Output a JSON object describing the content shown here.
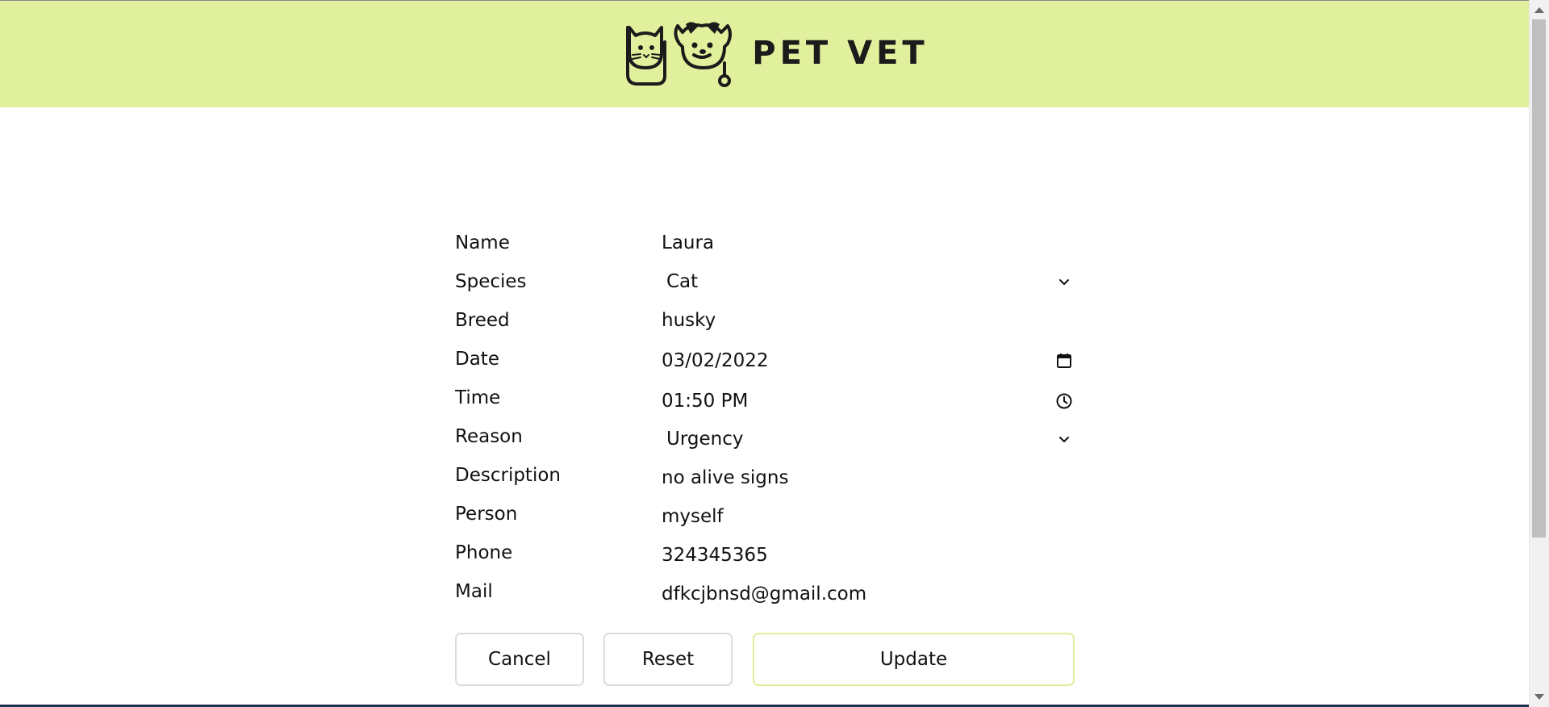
{
  "header": {
    "logo_text": "PET VET",
    "logo_mark": "cat-dog-stethoscope-logo",
    "background": "#e1f09c"
  },
  "form": {
    "fields": [
      {
        "label": "Name",
        "value": "Laura"
      },
      {
        "label": "Species",
        "value": "Cat",
        "control": "select"
      },
      {
        "label": "Breed",
        "value": "husky"
      },
      {
        "label": "Date",
        "value": "03/02/2022",
        "icon": "calendar-icon"
      },
      {
        "label": "Time",
        "value": "01:50 PM",
        "icon": "clock-icon"
      },
      {
        "label": "Reason",
        "value": "Urgency",
        "control": "select"
      },
      {
        "label": "Description",
        "value": "no alive signs"
      },
      {
        "label": "Person",
        "value": "myself"
      },
      {
        "label": "Phone",
        "value": "324345365"
      },
      {
        "label": "Mail",
        "value": "dfkcjbnsd@gmail.com"
      }
    ]
  },
  "buttons": {
    "cancel": "Cancel",
    "reset": "Reset",
    "update": "Update",
    "update_border": "#dfee9a"
  }
}
